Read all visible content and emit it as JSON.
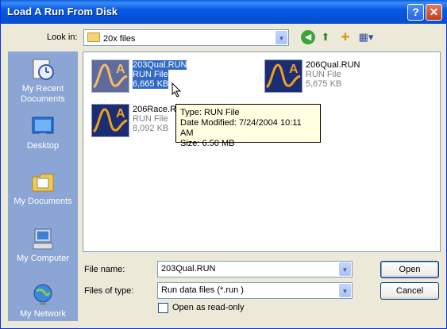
{
  "window": {
    "title": "Load A Run From Disk",
    "help_symbol": "?",
    "close_symbol": "✕"
  },
  "look_in": {
    "label": "Look in:",
    "value": "20x files"
  },
  "toolbar": {
    "back_icon": "back-arrow",
    "up_icon": "up-folder",
    "new_folder_icon": "new-folder",
    "views_icon": "views-menu"
  },
  "places": [
    {
      "label_line1": "My Recent",
      "label_line2": "Documents",
      "icon": "recent-documents"
    },
    {
      "label_line1": "Desktop",
      "label_line2": "",
      "icon": "desktop"
    },
    {
      "label_line1": "My Documents",
      "label_line2": "",
      "icon": "my-documents"
    },
    {
      "label_line1": "My Computer",
      "label_line2": "",
      "icon": "my-computer"
    },
    {
      "label_line1": "My Network",
      "label_line2": "",
      "icon": "my-network"
    }
  ],
  "files": [
    {
      "name": "203Qual.RUN",
      "type": "RUN File",
      "size": "6,665 KB",
      "selected": true
    },
    {
      "name": "206Qual.RUN",
      "type": "RUN File",
      "size": "5,675 KB",
      "selected": false
    },
    {
      "name": "206Race.RUN",
      "type": "RUN File",
      "size": "8,092 KB",
      "selected": false
    }
  ],
  "tooltip": {
    "type_line": "Type: RUN File",
    "modified_line": "Date Modified: 7/24/2004 10:11 AM",
    "size_line": "Size: 6.50 MB"
  },
  "file_name": {
    "label": "File name:",
    "value": "203Qual.RUN"
  },
  "files_of_type": {
    "label": "Files of type:",
    "value": "Run data files (*.run )"
  },
  "read_only": {
    "label": "Open as read-only",
    "checked": false
  },
  "buttons": {
    "open": "Open",
    "cancel": "Cancel"
  },
  "colors": {
    "title_bar": "#0858e5",
    "places_bar": "#8ba5d4",
    "selection": "#316ac5",
    "thumb_line": "#f0a020"
  }
}
